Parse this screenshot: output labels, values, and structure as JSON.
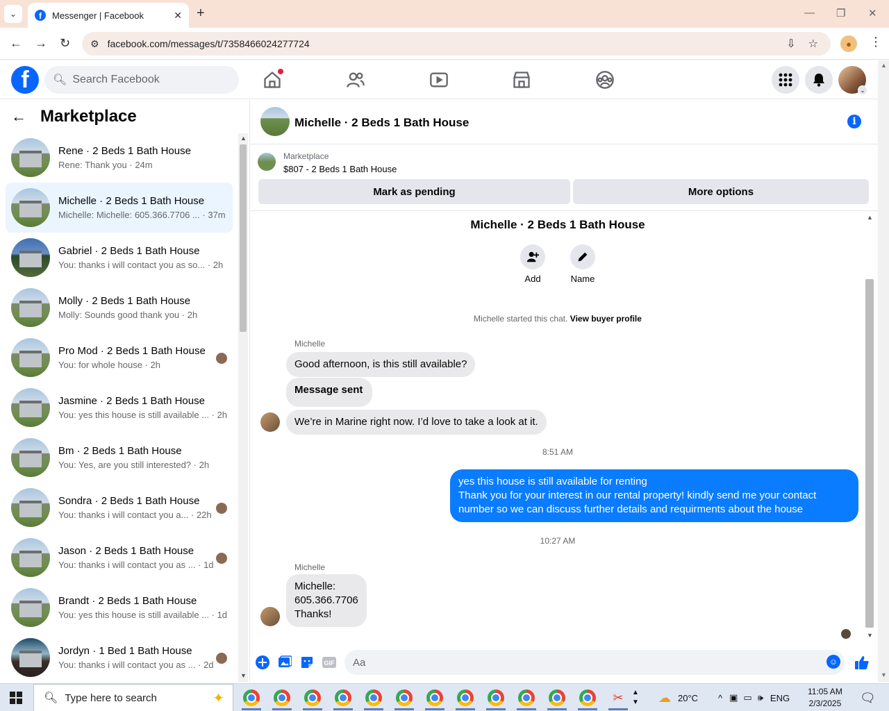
{
  "browser": {
    "tab_title": "Messenger | Facebook",
    "url": "facebook.com/messages/t/7358466024277724",
    "favicon_letter": "f",
    "new_tab": "+",
    "close_tab": "✕"
  },
  "fb": {
    "logo_letter": "f",
    "search_placeholder": "Search Facebook",
    "nav": [
      "home-icon",
      "friends-icon",
      "watch-icon",
      "marketplace-icon",
      "groups-icon"
    ],
    "has_notification_dot": true
  },
  "sidebar": {
    "title": "Marketplace",
    "conversations": [
      {
        "name": "Rene · 2 Beds 1 Bath House",
        "preview": "Rene: Thank you · 24m",
        "active": false,
        "mini": false
      },
      {
        "name": "Michelle · 2 Beds 1 Bath House",
        "preview": "Michelle: Michelle: 605.366.7706 ... · 37m",
        "active": true,
        "mini": false
      },
      {
        "name": "Gabriel · 2 Beds 1 Bath House",
        "preview": "You: thanks i will contact you as so... · 2h",
        "active": false,
        "mini": false
      },
      {
        "name": "Molly · 2 Beds 1 Bath House",
        "preview": "Molly: Sounds good thank you · 2h",
        "active": false,
        "mini": false
      },
      {
        "name": "Pro Mod · 2 Beds 1 Bath House",
        "preview": "You: for whole house · 2h",
        "active": false,
        "mini": true
      },
      {
        "name": "Jasmine · 2 Beds 1 Bath House",
        "preview": "You: yes this house is still available ... · 2h",
        "active": false,
        "mini": false
      },
      {
        "name": "Bm · 2 Beds 1 Bath House",
        "preview": "You: Yes, are you still interested? · 2h",
        "active": false,
        "mini": false
      },
      {
        "name": "Sondra · 2 Beds 1 Bath House",
        "preview": "You: thanks i will contact you a... · 22h",
        "active": false,
        "mini": true
      },
      {
        "name": "Jason · 2 Beds 1 Bath House",
        "preview": "You: thanks i will contact you as ... · 1d",
        "active": false,
        "mini": true
      },
      {
        "name": "Brandt · 2 Beds 1 Bath House",
        "preview": "You: yes this house is still available ... · 1d",
        "active": false,
        "mini": false
      },
      {
        "name": "Jordyn · 1 Bed 1 Bath House",
        "preview": "You: thanks i will contact you as ... · 2d",
        "active": false,
        "mini": true
      }
    ]
  },
  "chat": {
    "title": "Michelle · 2 Beds 1 Bath House",
    "info_glyph": "i",
    "listing": {
      "source": "Marketplace",
      "title": "$807 - 2 Beds 1 Bath House",
      "btn_pending": "Mark as pending",
      "btn_more": "More options"
    },
    "intro_title": "Michelle · 2 Beds 1 Bath House",
    "actions": {
      "add": "Add",
      "name": "Name"
    },
    "system_text": "Michelle started this chat.",
    "system_link": "View buyer profile",
    "sender_1": "Michelle",
    "msg_1": "Good afternoon, is this still available?",
    "msg_2": "Message sent",
    "msg_3": "We’re in Marine right now. I’d love to take a look at it.",
    "time_1": "8:51 AM",
    "out_line_1": "yes this house is still available for renting",
    "out_line_2": "Thank you for your interest in our rental property! kindly send me your contact",
    "out_line_3": "number so we can discuss further details and requirments about the house",
    "time_2": "10:27 AM",
    "sender_2": "Michelle",
    "msg_4_line_1": "Michelle:",
    "msg_4_line_2": "605.366.7706",
    "msg_4_line_3": "Thanks!",
    "composer_placeholder": "Aa"
  },
  "taskbar": {
    "search_placeholder": "Type here to search",
    "app_count": 12,
    "weather": "20°C",
    "language": "ENG",
    "time": "11:05 AM",
    "date": "2/3/2025"
  }
}
